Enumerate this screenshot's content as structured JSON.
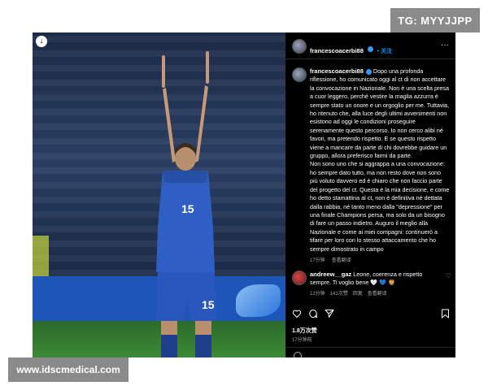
{
  "watermark_top": "TG: MYYJJPP",
  "watermark_bottom": "www.idscmedical.com",
  "post": {
    "username": "francescoacerbi88",
    "follow_label": "• 关注",
    "jersey_number": "15",
    "caption_username": "francescoacerbi88",
    "caption": "Dopo una profonda riflessione, ho comunicato oggi al ct di non accettare la convocazione in Nazionale. Non è una scelta presa a cuor leggero, perché vestire la maglia azzurra è sempre stato un onore e un orgoglio per me. Tuttavia, ho ritenuto che, alla luce degli ultimi avvenimenti non esistono ad oggi le condizioni proseguire serenamente questo percorso. Io non cerco alibi né favori, ma pretendo rispetto. E se questo rispetto viene a mancare da parte di chi dovrebbe guidare un gruppo, allora preferisco farmi da parte.\nNon sono uno che si aggrappa a una convocazione: ho sempre dato tutto, ma non resto dove non sono più voluto davvero ed è chiaro che non faccio parte del progetto del ct. Questa è la mia decisione, e come ho detto stamattina al ct, non è definitiva né dettata dalla rabbia, né tanto meno dalla \"depressione\" per una finale Champions persa, ma solo da un bisogno di fare un passo indietro. Auguro il meglio alla Nazionale e come ai miei compagni: continuerò a tifare per loro con lo stesso attaccamento che ho sempre dimostrato in campo",
    "caption_time": "17分钟",
    "caption_translate": "查看翻译",
    "comment": {
      "username": "andreew__gaz",
      "text": "Leone, coerenza e rispetto sempre. Ti voglio bene 🤍 💙 🦁",
      "time": "12分钟",
      "likes": "141次赞",
      "reply": "回复",
      "translate": "查看翻译"
    },
    "likes": "1.8万次赞",
    "time": "17分钟前",
    "icons": {
      "download": "download-icon",
      "like": "heart-icon",
      "comment": "comment-icon",
      "share": "share-icon",
      "save": "bookmark-icon",
      "more": "more-icon"
    }
  }
}
